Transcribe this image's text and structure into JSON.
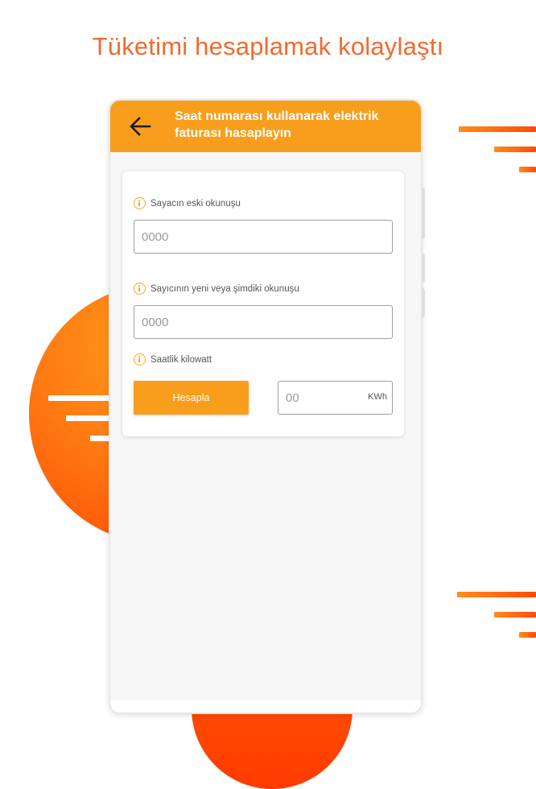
{
  "headline": "Tüketimi hesaplamak kolaylaştı",
  "appbar": {
    "title": "Saat numarası kullanarak elektrik faturası hasaplayın",
    "back_icon": "arrow-left-icon"
  },
  "form": {
    "old_reading": {
      "label": "Sayacın eski okunuşu",
      "placeholder": "0000",
      "icon": "info-icon"
    },
    "new_reading": {
      "label": "Sayıcının yeni veya şimdiki okunuşu",
      "placeholder": "0000",
      "icon": "info-icon"
    },
    "kwh": {
      "label": "Saatlik kilowatt",
      "icon": "info-icon"
    },
    "calculate_button": "Hesapla",
    "result": {
      "placeholder": "00",
      "unit": "KWh"
    }
  },
  "colors": {
    "accent": "#f99e1c",
    "headline": "#f26a2e",
    "decor_orange": "#ff7a12"
  }
}
